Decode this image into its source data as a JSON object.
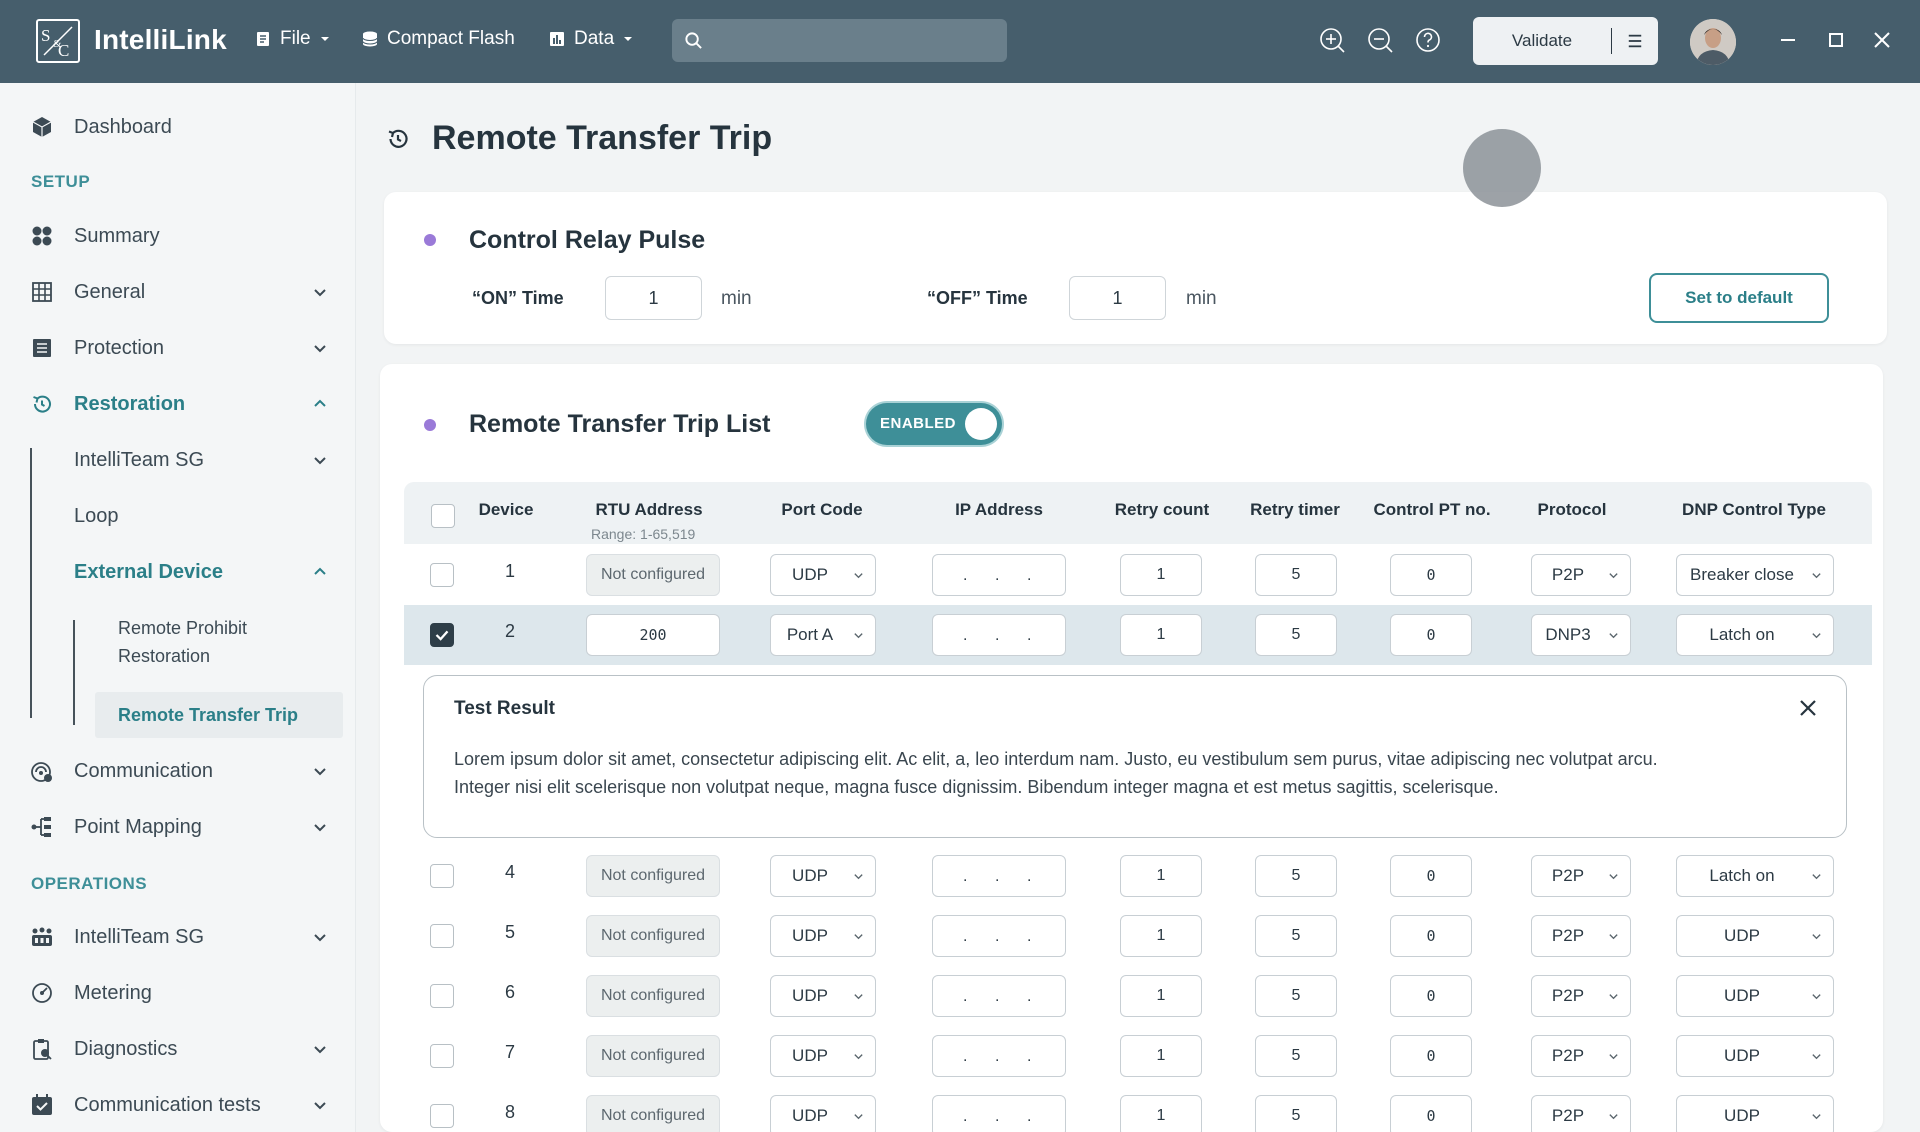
{
  "app": {
    "name": "IntelliLink",
    "menu": {
      "file": "File",
      "compact_flash": "Compact Flash",
      "data": "Data"
    },
    "search": {
      "placeholder": ""
    },
    "validate": "Validate"
  },
  "sidebar": {
    "dashboard": "Dashboard",
    "setup_label": "SETUP",
    "summary": "Summary",
    "general": "General",
    "protection": "Protection",
    "restoration": "Restoration",
    "intelliteam_sg": "IntelliTeam SG",
    "loop": "Loop",
    "external_device": "External Device",
    "remote_prohibit_1": "Remote Prohibit",
    "remote_prohibit_2": "Restoration",
    "remote_transfer_trip": "Remote Transfer Trip",
    "communication": "Communication",
    "point_mapping": "Point Mapping",
    "operations_label": "OPERATIONS",
    "ops_intelliteam_sg": "IntelliTeam SG",
    "metering": "Metering",
    "diagnostics": "Diagnostics",
    "communication_tests": "Communication tests"
  },
  "page": {
    "title": "Remote Transfer Trip"
  },
  "control_relay_pulse": {
    "title": "Control Relay Pulse",
    "on_label": "“ON” Time",
    "on_value": "1",
    "on_unit": "min",
    "off_label": "“OFF” Time",
    "off_value": "1",
    "off_unit": "min",
    "set_default": "Set to default"
  },
  "trip_list": {
    "title": "Remote Transfer Trip List",
    "toggle_label": "ENABLED",
    "headers": {
      "device": "Device",
      "rtu_address": "RTU Address",
      "rtu_range": "Range: 1-65,519",
      "port_code": "Port Code",
      "ip_address": "IP Address",
      "retry_count": "Retry count",
      "retry_timer": "Retry timer",
      "control_pt": "Control PT no.",
      "protocol": "Protocol",
      "dnp_control": "DNP Control Type"
    },
    "rows": [
      {
        "device": "1",
        "rtu": "Not configured",
        "port": "UDP",
        "retry_count": "1",
        "retry_timer": "5",
        "control_pt": "0",
        "protocol": "P2P",
        "dnp": "Breaker close",
        "checked": false
      },
      {
        "device": "2",
        "rtu": "200",
        "port": "Port A",
        "retry_count": "1",
        "retry_timer": "5",
        "control_pt": "0",
        "protocol": "DNP3",
        "dnp": "Latch on",
        "checked": true
      },
      {
        "device": "4",
        "rtu": "Not configured",
        "port": "UDP",
        "retry_count": "1",
        "retry_timer": "5",
        "control_pt": "0",
        "protocol": "P2P",
        "dnp": "Latch on",
        "checked": false
      },
      {
        "device": "5",
        "rtu": "Not configured",
        "port": "UDP",
        "retry_count": "1",
        "retry_timer": "5",
        "control_pt": "0",
        "protocol": "P2P",
        "dnp": "UDP",
        "checked": false
      },
      {
        "device": "6",
        "rtu": "Not configured",
        "port": "UDP",
        "retry_count": "1",
        "retry_timer": "5",
        "control_pt": "0",
        "protocol": "P2P",
        "dnp": "UDP",
        "checked": false
      },
      {
        "device": "7",
        "rtu": "Not configured",
        "port": "UDP",
        "retry_count": "1",
        "retry_timer": "5",
        "control_pt": "0",
        "protocol": "P2P",
        "dnp": "UDP",
        "checked": false
      },
      {
        "device": "8",
        "rtu": "Not configured",
        "port": "UDP",
        "retry_count": "1",
        "retry_timer": "5",
        "control_pt": "0",
        "protocol": "P2P",
        "dnp": "UDP",
        "checked": false
      }
    ]
  },
  "test_result": {
    "title": "Test Result",
    "line1": "Lorem ipsum dolor sit amet, consectetur adipiscing elit. Ac elit, a, leo interdum nam. Justo, eu vestibulum sem purus, vitae adipiscing nec volutpat arcu.",
    "line2": "Integer nisi elit scelerisque non volutpat neque, magna fusce dignissim. Bibendum integer magna et est metus sagittis, scelerisque."
  },
  "colors": {
    "topbar": "#465e6c",
    "accent": "#3e8f98",
    "bullet": "#9a7ad8",
    "selected_row": "#dde7ec"
  }
}
